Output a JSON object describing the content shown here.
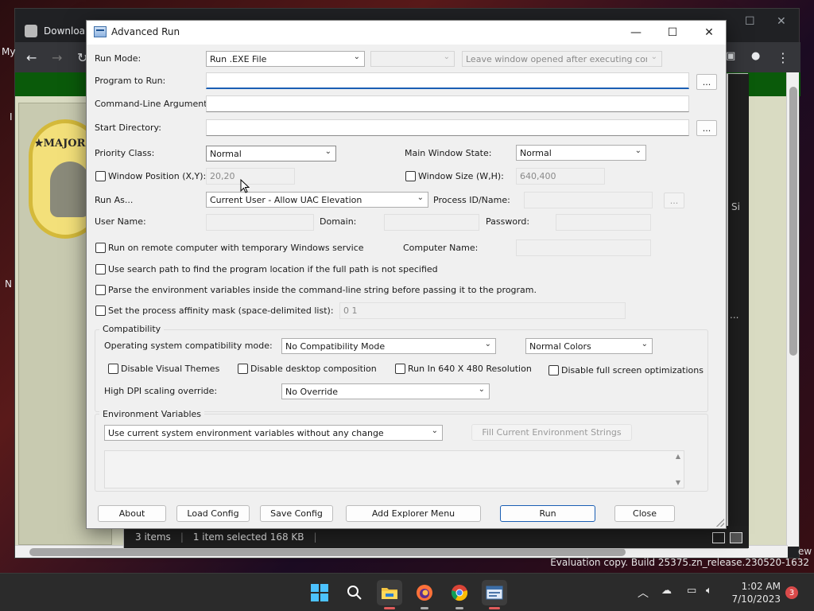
{
  "browser": {
    "tab_label": "Downloa",
    "side_fragment_my": "My",
    "side_fragment_i": "I",
    "side_fragment_n": "N",
    "logo_text": "★MAJOR"
  },
  "explorer": {
    "items_count": "3 items",
    "selection": "1 item selected  168 KB",
    "side_label_si": "Si",
    "side_label_ew": "ew",
    "side_label_dots": "..."
  },
  "dialog": {
    "title": "Advanced Run",
    "run_mode_label": "Run Mode:",
    "run_mode_value": "Run .EXE File",
    "run_mode_extra": "",
    "leave_window": "Leave window opened after executing command",
    "program_label": "Program to Run:",
    "program_value": "",
    "cmdline_label": "Command-Line Arguments:",
    "cmdline_value": "",
    "startdir_label": "Start Directory:",
    "startdir_value": "",
    "browse_label": "...",
    "priority_label": "Priority Class:",
    "priority_value": "Normal",
    "main_window_state_label": "Main Window State:",
    "main_window_state_value": "Normal",
    "window_position_label": "Window Position (X,Y):",
    "window_position_value": "20,20",
    "window_size_label": "Window Size (W,H):",
    "window_size_value": "640,400",
    "run_as_label": "Run As...",
    "run_as_value": "Current User - Allow UAC Elevation",
    "process_id_label": "Process ID/Name:",
    "user_name_label": "User Name:",
    "domain_label": "Domain:",
    "password_label": "Password:",
    "remote_label": "Run on remote computer with temporary Windows service",
    "computer_name_label": "Computer Name:",
    "search_path_label": "Use search path to find the program location if the full path is not specified",
    "parse_env_label": "Parse the environment variables inside the command-line string before passing it to the program.",
    "affinity_label": "Set the process affinity mask (space-delimited list):",
    "affinity_value": "0 1",
    "compat_group": "Compatibility",
    "os_compat_label": "Operating system compatibility mode:",
    "os_compat_value": "No Compatibility Mode",
    "colors_value": "Normal Colors",
    "disable_visual_themes": "Disable Visual Themes",
    "disable_desktop_composition": "Disable desktop composition",
    "run_640": "Run In 640 X 480 Resolution",
    "disable_fullscreen_opt": "Disable full screen optimizations",
    "high_dpi_label": "High DPI scaling override:",
    "high_dpi_value": "No Override",
    "env_group": "Environment Variables",
    "env_value": "Use current system environment variables without any change",
    "fill_env_button": "Fill Current Environment Strings",
    "buttons": {
      "about": "About",
      "load_config": "Load Config",
      "save_config": "Save Config",
      "add_explorer_menu": "Add Explorer Menu",
      "run": "Run",
      "close": "Close"
    }
  },
  "desktop": {
    "evaluation": "Evaluation copy. Build 25375.zn_release.230520-1632"
  },
  "taskbar": {
    "time": "1:02 AM",
    "date": "7/10/2023",
    "notifications": "3"
  }
}
